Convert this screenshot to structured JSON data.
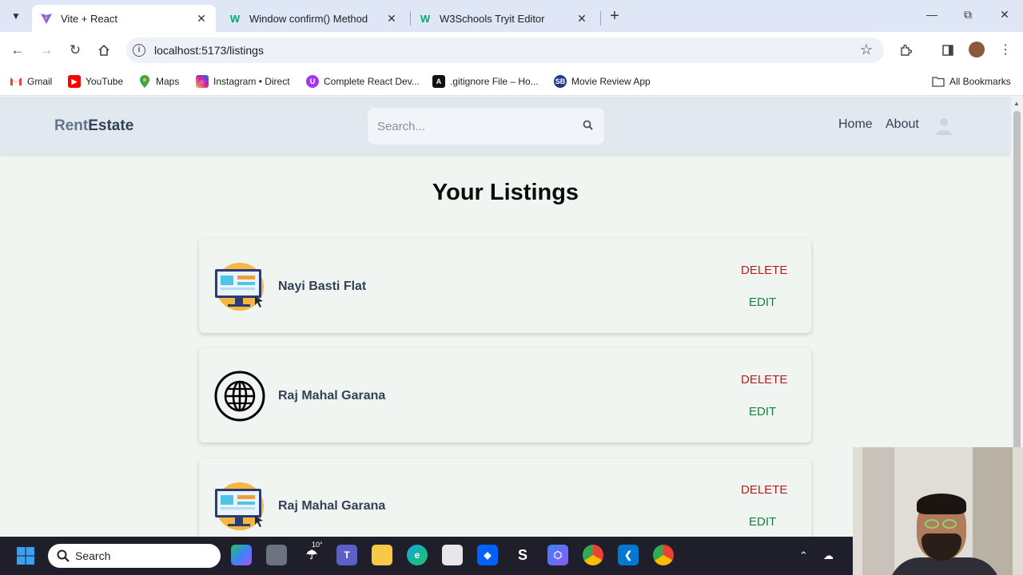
{
  "browser": {
    "tabs": [
      {
        "title": "Vite + React",
        "active": true,
        "icon": "vite-icon"
      },
      {
        "title": "Window confirm() Method",
        "active": false,
        "icon": "w3schools-icon"
      },
      {
        "title": "W3Schools Tryit Editor",
        "active": false,
        "icon": "w3schools-icon"
      }
    ],
    "url": "localhost:5173/listings",
    "bookmarks": [
      {
        "label": "Gmail",
        "icon": "gmail-icon",
        "color": "#ea4335"
      },
      {
        "label": "YouTube",
        "icon": "youtube-icon",
        "color": "#ff0000"
      },
      {
        "label": "Maps",
        "icon": "maps-icon",
        "color": "#34a853"
      },
      {
        "label": "Instagram • Direct",
        "icon": "instagram-icon",
        "color": "#d6249f"
      },
      {
        "label": "Complete React Dev...",
        "icon": "udemy-icon",
        "color": "#a435f0"
      },
      {
        "label": ".gitignore File – Ho...",
        "icon": "codebase-icon",
        "color": "#111111"
      },
      {
        "label": "Movie Review App",
        "icon": "sb-icon",
        "color": "#1e3a8a"
      }
    ],
    "all_bookmarks": "All Bookmarks"
  },
  "app": {
    "logo_part1": "Rent",
    "logo_part2": "Estate",
    "search_placeholder": "Search...",
    "nav": {
      "home": "Home",
      "about": "About"
    },
    "page_title": "Your Listings",
    "listings": [
      {
        "name": "Nayi Basti Flat",
        "image": "computer-illustration",
        "delete": "DELETE",
        "edit": "EDIT"
      },
      {
        "name": "Raj Mahal Garana",
        "image": "globe-icon",
        "delete": "DELETE",
        "edit": "EDIT"
      },
      {
        "name": "Raj Mahal Garana",
        "image": "computer-illustration",
        "delete": "DELETE",
        "edit": "EDIT"
      }
    ]
  },
  "taskbar": {
    "search_label": "Search",
    "weather": "10°"
  },
  "colors": {
    "delete": "#b91c1c",
    "edit": "#15803d",
    "header_bg": "#e2e8f0"
  }
}
